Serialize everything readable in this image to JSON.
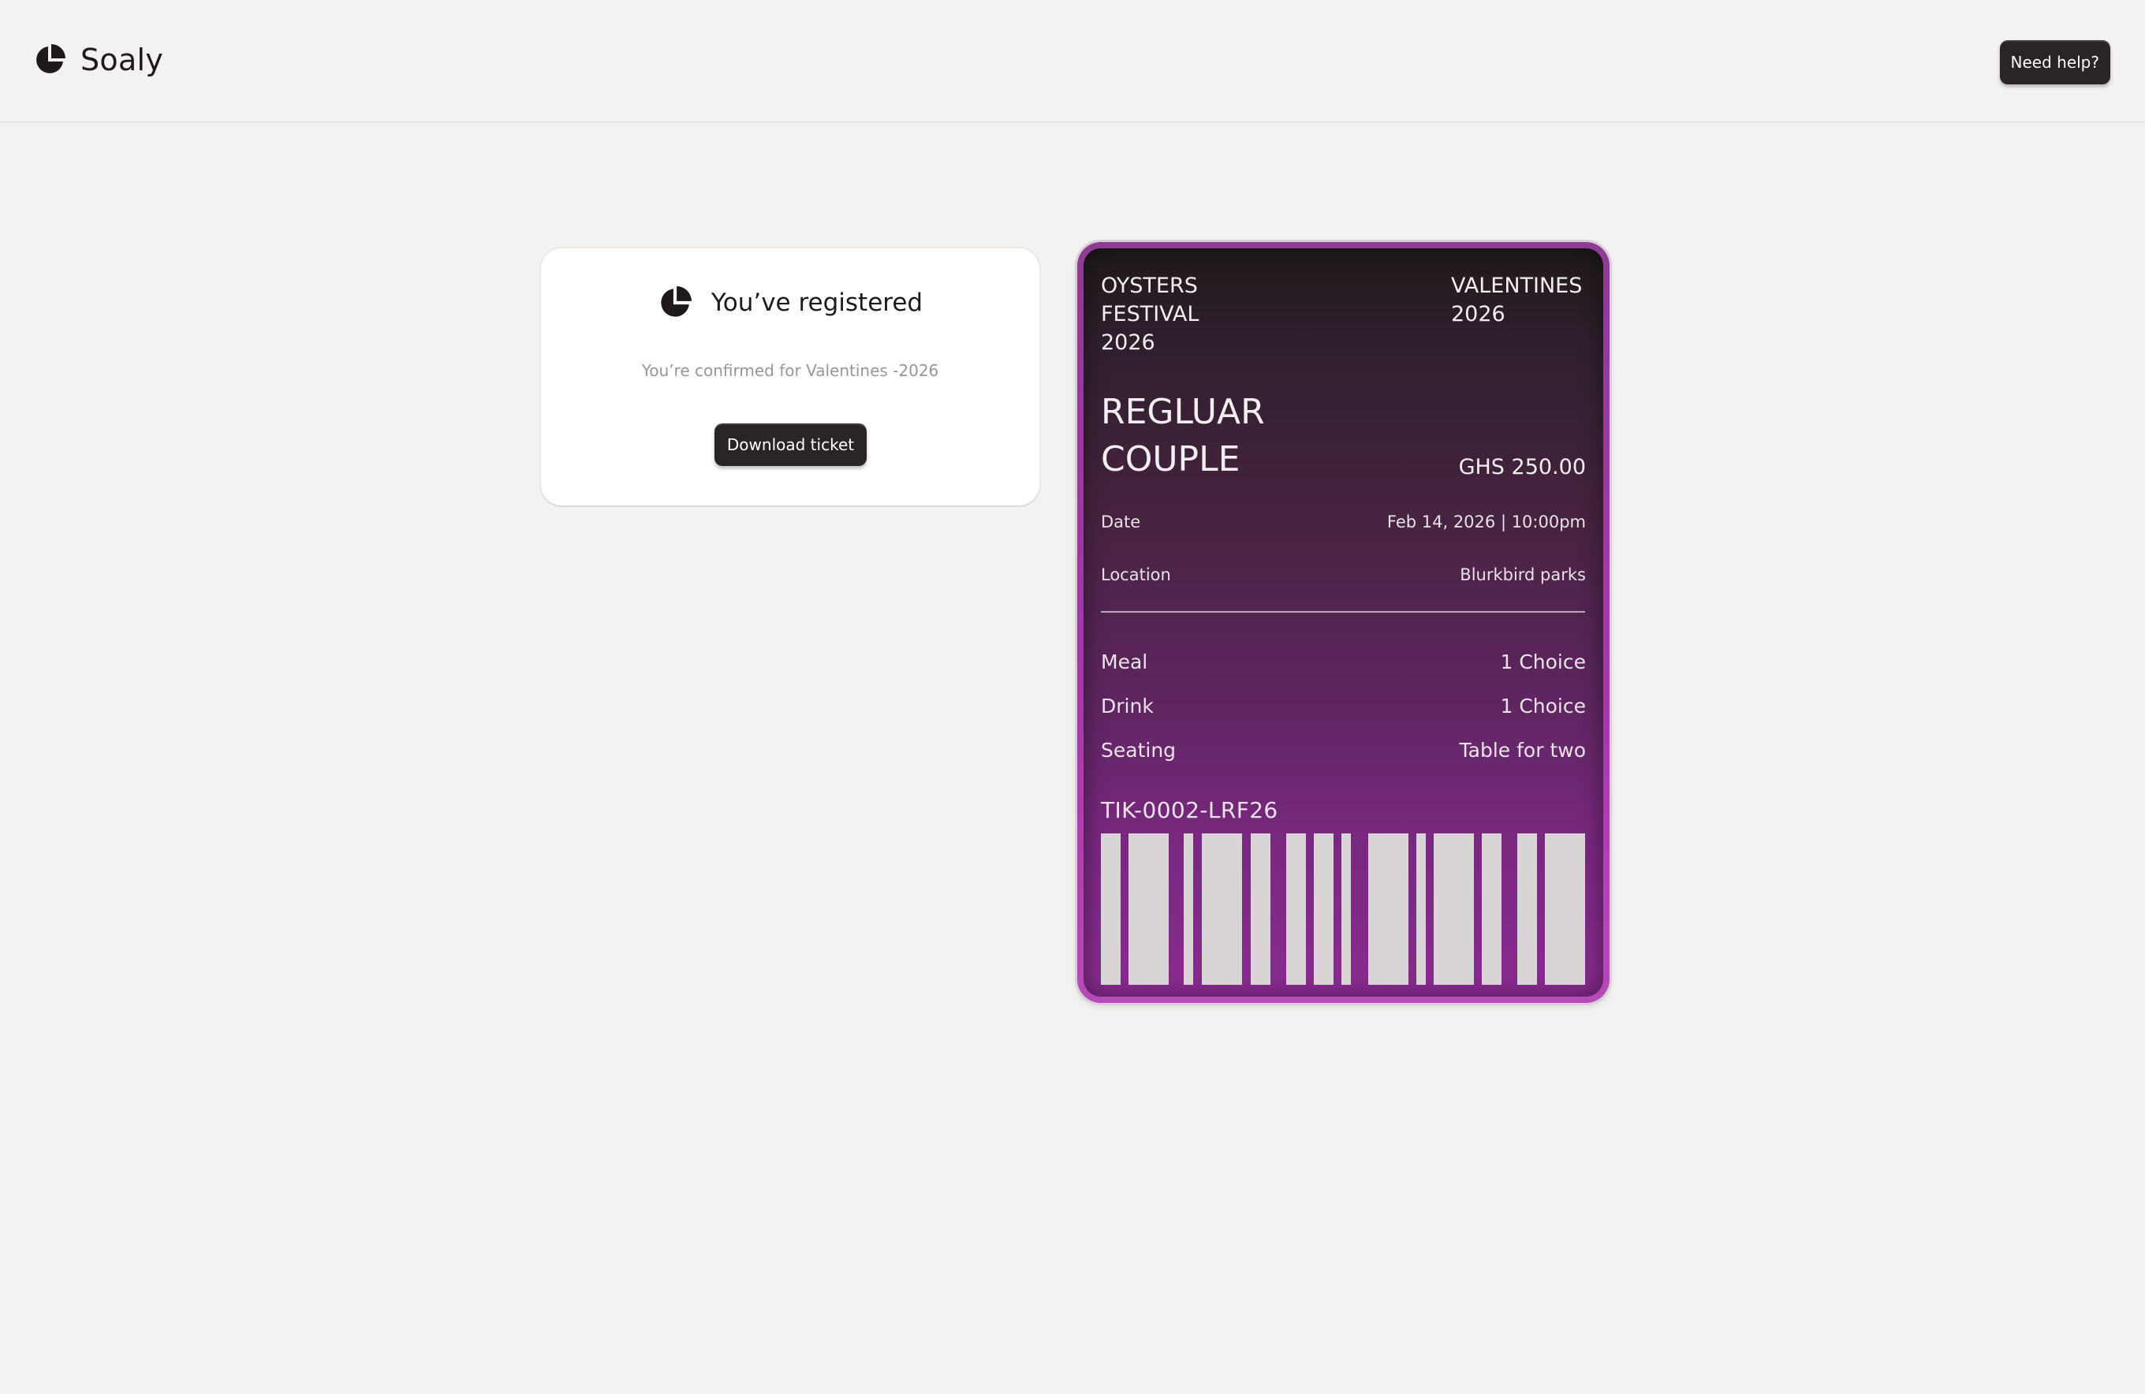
{
  "header": {
    "brand_name": "Soaly",
    "brand_icon": "pie-logo-icon",
    "help_label": "Need help?"
  },
  "confirmation": {
    "icon": "pie-logo-icon",
    "title": "You’ve registered",
    "subtitle": "You’re confirmed for Valentines -2026",
    "download_label": "Download ticket"
  },
  "ticket": {
    "event_lines": [
      "OYSTERS",
      "FESTIVAL",
      "2026"
    ],
    "edition_lines": [
      "VALENTINES",
      "2026"
    ],
    "type_lines": [
      "REGLUAR",
      "COUPLE"
    ],
    "price": "GHS 250.00",
    "details": [
      {
        "label": "Date",
        "value": "Feb 14, 2026 | 10:00pm"
      },
      {
        "label": "Location",
        "value": "Blurkbird parks"
      }
    ],
    "items": [
      {
        "label": "Meal",
        "value": "1 Choice"
      },
      {
        "label": "Drink",
        "value": "1 Choice"
      },
      {
        "label": "Seating",
        "value": "Table for two"
      }
    ],
    "code": "TIK-0002-LRF26"
  },
  "colors": {
    "page_bg": "#f3f2f0",
    "dark_button": "#2b2424",
    "ticket_accent": "#a43aa8",
    "ticket_dark": "#201a1a"
  }
}
